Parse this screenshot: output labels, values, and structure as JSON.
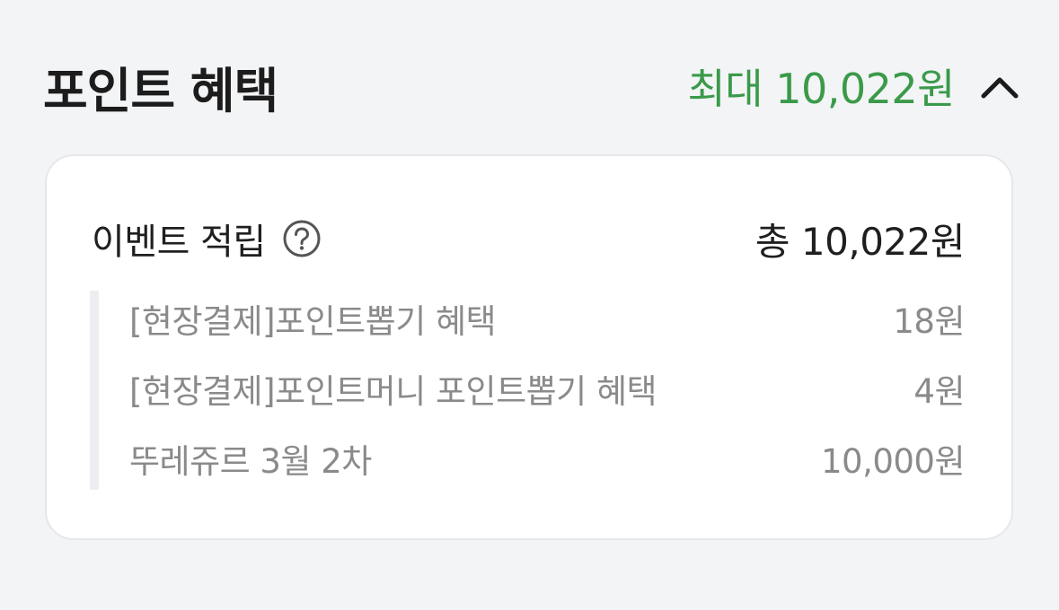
{
  "header": {
    "title": "포인트 혜택",
    "max_amount": "최대 10,022원",
    "toggle_icon": "chevron-up-icon"
  },
  "event_section": {
    "title": "이벤트 적립",
    "help_icon": "question-circle-icon",
    "total": "총 10,022원",
    "items": [
      {
        "label": "[현장결제]포인트뽑기 혜택",
        "value": "18원"
      },
      {
        "label": "[현장결제]포인트머니 포인트뽑기 혜택",
        "value": "4원"
      },
      {
        "label": "뚜레쥬르 3월 2차",
        "value": "10,000원"
      }
    ]
  },
  "colors": {
    "accent_green": "#3a9a4a",
    "background": "#f3f4f6",
    "card": "#ffffff",
    "muted_text": "#8a8a8a"
  }
}
